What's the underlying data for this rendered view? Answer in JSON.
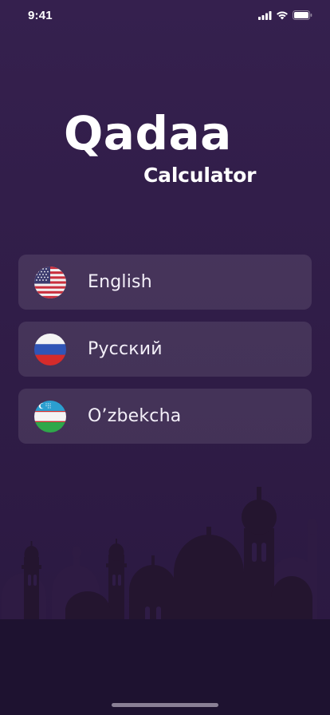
{
  "status_bar": {
    "time": "9:41"
  },
  "logo": {
    "title": "Qadaa",
    "subtitle": "Calculator"
  },
  "languages": [
    {
      "label": "English",
      "flag": "us-flag-icon"
    },
    {
      "label": "Русский",
      "flag": "russia-flag-icon"
    },
    {
      "label": "O’zbekcha",
      "flag": "uzbekistan-flag-icon"
    }
  ],
  "colors": {
    "background": "#35204e",
    "card": "rgba(255,255,255,0.10)",
    "text": "#ffffff",
    "skyline": "#1e1230"
  }
}
